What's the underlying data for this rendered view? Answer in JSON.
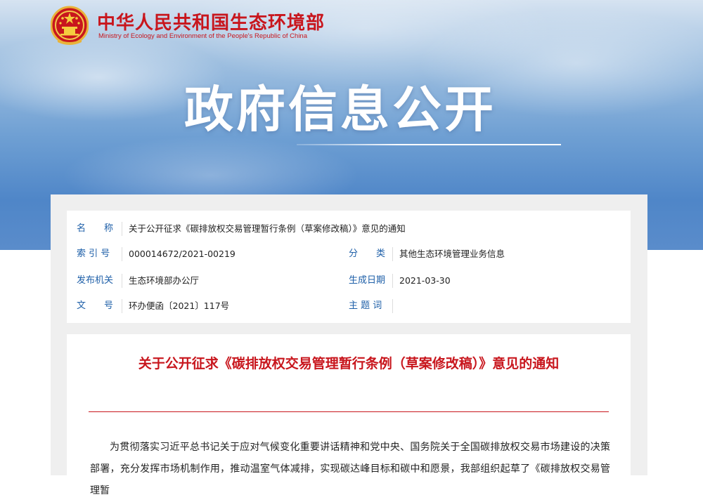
{
  "header": {
    "site_title": "中华人民共和国生态环境部",
    "site_subtitle": "Ministry of Ecology and Environment of the People's Republic of China",
    "banner_heading": "政府信息公开"
  },
  "colors": {
    "brand_red": "#c8161d",
    "label_blue": "#1e5fa8"
  },
  "icons": {
    "emblem": "national-emblem-icon"
  },
  "meta": {
    "name_label": "名　　称",
    "name_value": "关于公开征求《碳排放权交易管理暂行条例（草案修改稿）》意见的通知",
    "index_label": "索 引 号",
    "index_value": "000014672/2021-00219",
    "category_label": "分　　类",
    "category_value": "其他生态环境管理业务信息",
    "issuer_label": "发布机关",
    "issuer_value": "生态环境部办公厅",
    "date_label": "生成日期",
    "date_value": "2021-03-30",
    "doc_no_label": "文　　号",
    "doc_no_value": "环办便函〔2021〕117号",
    "subject_label": "主 题 词",
    "subject_value": ""
  },
  "article": {
    "title": "关于公开征求《碳排放权交易管理暂行条例（草案修改稿）》意见的通知",
    "body": "为贯彻落实习近平总书记关于应对气候变化重要讲话精神和党中央、国务院关于全国碳排放权交易市场建设的决策部署，充分发挥市场机制作用，推动温室气体减排，实现碳达峰目标和碳中和愿景，我部组织起草了《碳排放权交易管理暂"
  }
}
